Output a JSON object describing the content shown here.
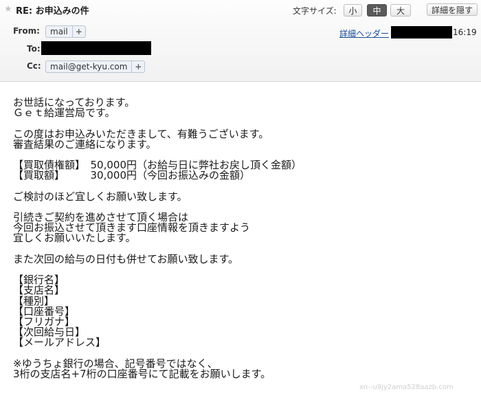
{
  "header": {
    "subject": "RE: お申込みの件",
    "font_size_label": "文字サイズ:",
    "font_size_options": [
      "小",
      "中",
      "大"
    ],
    "font_size_selected": "中",
    "hide_details_label": "詳細を隠す",
    "from_label": "From:",
    "from_value": "mail",
    "to_label": "To:",
    "cc_label": "Cc:",
    "cc_value": "mail@get-kyu.com",
    "add_symbol": "+",
    "detail_header_link": "詳細ヘッダー",
    "time": "16:19"
  },
  "body": {
    "lines": [
      "お世話になっております。",
      "Ｇｅｔ給運営局です。",
      "",
      "この度はお申込みいただきまして、有難うございます。",
      "審査結果のご連絡になります。",
      "",
      "【買取債権額】　50,000円（お給与日に弊社お戻し頂く金額）",
      "【買取額】　　　30,000円（今回お振込みの金額）",
      "",
      "ご検討のほど宜しくお願い致します。",
      "",
      "引続きご契約を進めさせて頂く場合は",
      "今回お振込させて頂きます口座情報を頂きますよう",
      "宜しくお願いいたします。",
      "",
      "また次回の給与の日付も併せてお願い致します。",
      "",
      "【銀行名】",
      "【支店名】",
      "【種別】",
      "【口座番号】",
      "【フリガナ】",
      "【次回給与日】",
      "【メールアドレス】",
      "",
      "※ゆうちょ銀行の場合、記号番号ではなく、",
      "3桁の支店名+7桁の口座番号にて記載をお願いします。"
    ]
  },
  "watermark": "xn--u9jy2ama528aazb.com"
}
